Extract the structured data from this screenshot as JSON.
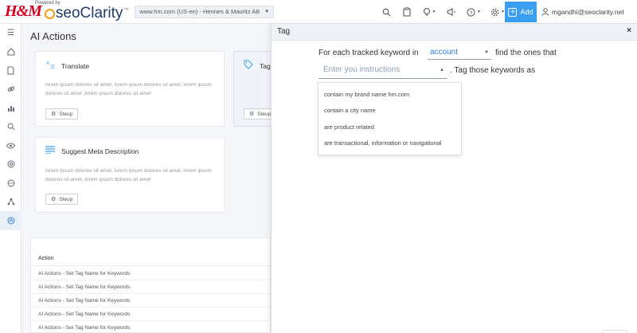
{
  "header": {
    "powered_by": "Powered by",
    "brand_hm": "H&M",
    "brand_seo": "seoClarity",
    "trademark": "™",
    "domain_select": "www.hm.com (US-en) - Hennes & Mauritz AB",
    "add_label": "Add",
    "user_email": "mgandhi@seoclarity.net"
  },
  "main": {
    "page_title": "AI Actions",
    "cards": [
      {
        "title": "Translate",
        "description": "lorem ipsum dolores sit amet, lorem ipsum dolores sit amet, lorem ipsum dolores sit amet ,lorem ipsum dolores sit amet",
        "button": "Steup"
      },
      {
        "title": "Tag",
        "button": "Steup"
      },
      {
        "title": "Suggest Meta Description",
        "description": "lorem ipsum dolores sit amet, lorem ipsum dolores sit amet, lorem ipsum dolores sit amet ,lorem ipsum dolores sit amet",
        "button": "Steup"
      }
    ],
    "table": {
      "header": "Action",
      "rows": [
        "AI Actions - Set Tag Name for Keywords",
        "AI Actions - Set Tag Name for Keywords",
        "AI Actions - Set Tag Name for Keywords",
        "AI Actions - Set Tag Name for Keywords",
        "AI Actions - Set Tag Name for Keywords"
      ]
    }
  },
  "panel": {
    "title": "Tag",
    "close": "×",
    "sentence_1a": "For each tracked keyword in",
    "account_value": "account",
    "sentence_1b": "find the ones that",
    "instructions_placeholder": "Enter you instructions",
    "sentence_2": ". Tag those keywords as",
    "options": [
      "contain my brand name hm.com",
      "contain a city name",
      "are product related",
      "are transactional, information or navigational"
    ]
  },
  "colors": {
    "accent": "#3a9ff0",
    "brand_red": "#d7001d",
    "link_blue": "#2f7bd4"
  }
}
